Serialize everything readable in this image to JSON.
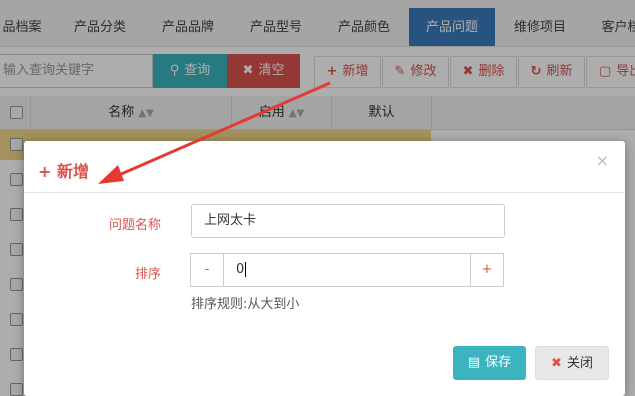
{
  "tabs": [
    "品档案",
    "产品分类",
    "产品品牌",
    "产品型号",
    "产品颜色",
    "产品问题",
    "维修项目",
    "客户档"
  ],
  "active_tab": "产品问题",
  "toolbar": {
    "search_placeholder": "输入查询关键字",
    "query_label": "查询",
    "clear_label": "清空",
    "add_label": "新增",
    "edit_label": "修改",
    "delete_label": "删除",
    "refresh_label": "刷新",
    "export_label": "导出"
  },
  "table": {
    "columns": [
      "名称",
      "启用",
      "默认"
    ]
  },
  "modal": {
    "title": "新增",
    "name_label": "问题名称",
    "name_value": "上网太卡",
    "sort_label": "排序",
    "sort_value": "0",
    "minus": "-",
    "plus": "+",
    "hint": "排序规则:从大到小",
    "save_label": "保存",
    "close_label": "关闭",
    "close_icon": "×"
  },
  "colors": {
    "accent": "#3bb4bf",
    "danger": "#d9534f",
    "tab_active": "#3a7bbf",
    "row_highlight": "#f0d88c"
  }
}
